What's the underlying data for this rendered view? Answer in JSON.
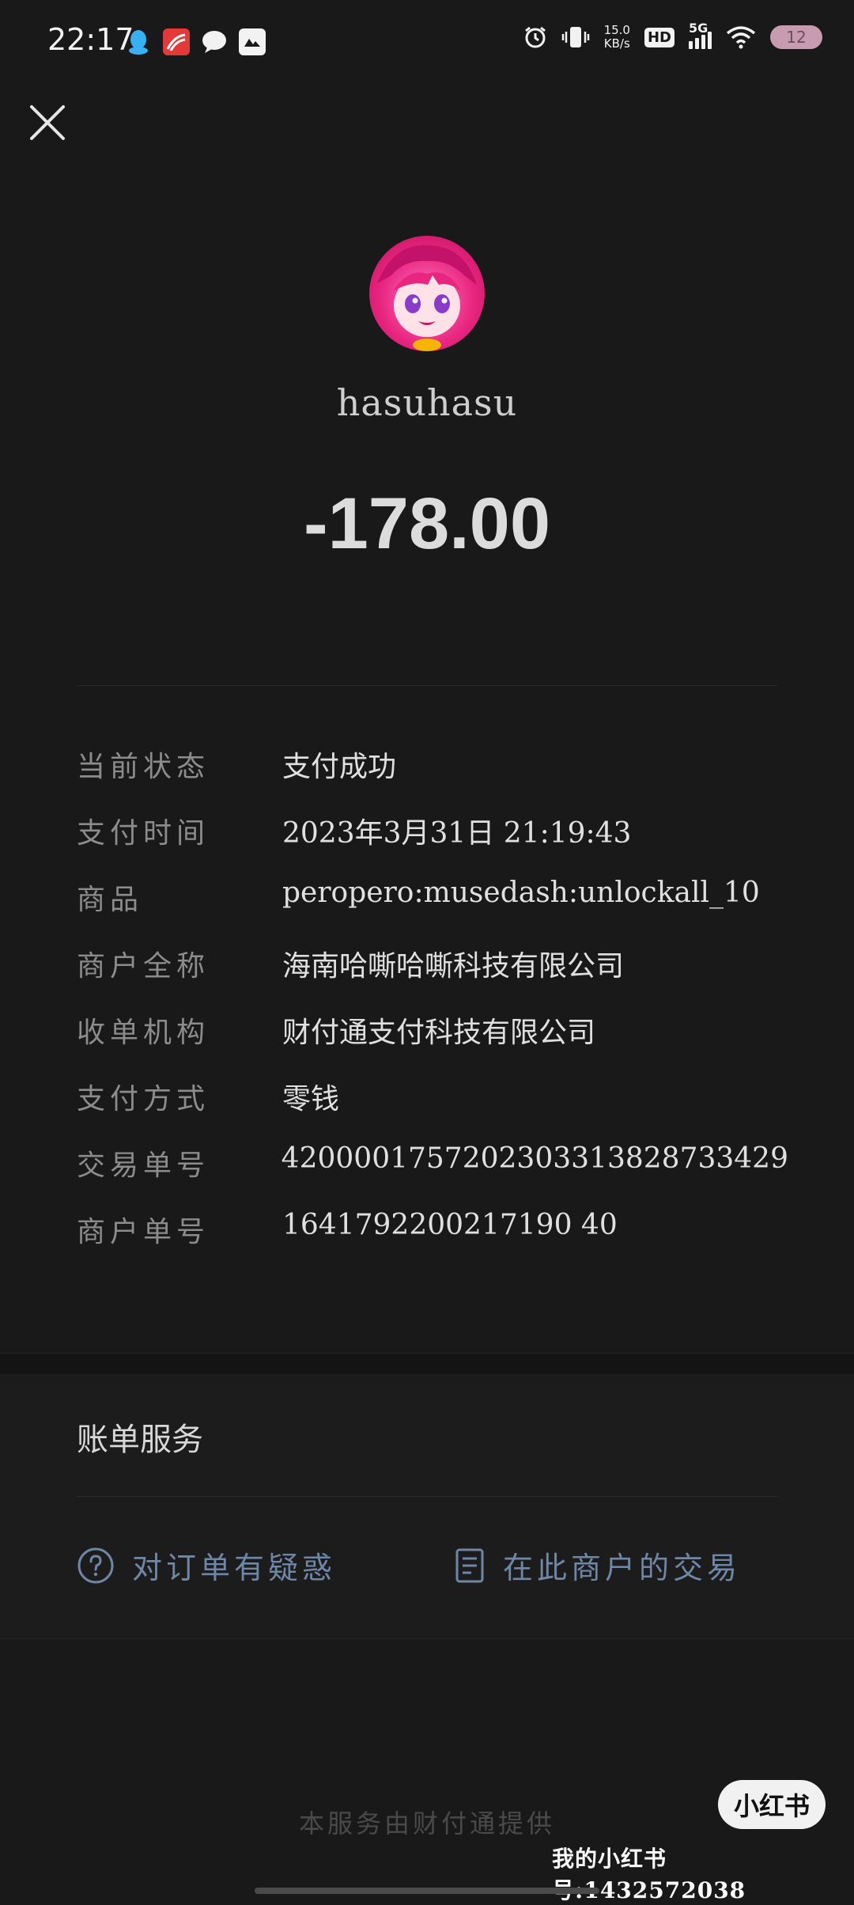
{
  "status_bar": {
    "time": "22:17",
    "net_speed_value": "15.0",
    "net_speed_unit": "KB/s",
    "hd_label": "HD",
    "network_label": "5G",
    "battery_level": "12"
  },
  "header": {
    "payee_name": "hasuhasu",
    "amount": "-178.00"
  },
  "details": [
    {
      "label": "当前状态",
      "value": "支付成功"
    },
    {
      "label": "支付时间",
      "value": "2023年3月31日 21:19:43"
    },
    {
      "label": "商品",
      "value": "peropero:musedash:unlockall_10"
    },
    {
      "label": "商户全称",
      "value": "海南哈嘶哈嘶科技有限公司"
    },
    {
      "label": "收单机构",
      "value": "财付通支付科技有限公司"
    },
    {
      "label": "支付方式",
      "value": "零钱"
    },
    {
      "label": "交易单号",
      "value": "4200001757202303313828733429"
    },
    {
      "label": "商户单号",
      "value": "1641792200217190 40"
    }
  ],
  "services": {
    "title": "账单服务",
    "question_link": "对订单有疑惑",
    "merchant_link": "在此商户的交易"
  },
  "footer": {
    "note": "本服务由财付通提供"
  },
  "watermark": {
    "badge": "小红书",
    "id_text": "我的小红书号:1432572038"
  },
  "colors": {
    "background": "#191919",
    "link": "#6f87a6"
  }
}
